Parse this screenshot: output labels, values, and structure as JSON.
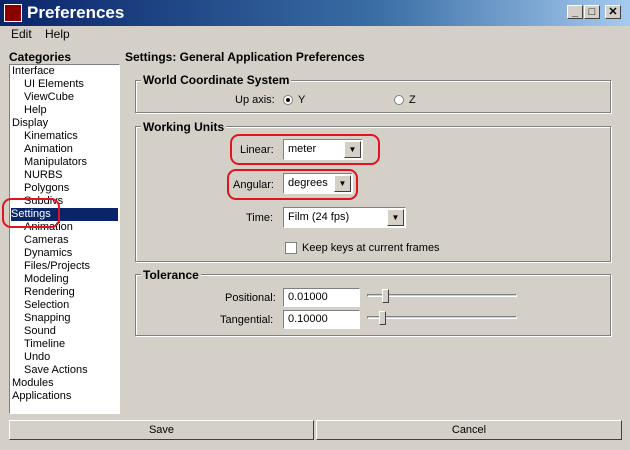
{
  "window": {
    "title": "Preferences",
    "minimize": "_",
    "maximize": "□",
    "close": "✕"
  },
  "menu": [
    "Edit",
    "Help"
  ],
  "categories": {
    "heading": "Categories",
    "items": [
      {
        "label": "Interface",
        "level": 0
      },
      {
        "label": "UI Elements",
        "level": 1
      },
      {
        "label": "ViewCube",
        "level": 1
      },
      {
        "label": "Help",
        "level": 1
      },
      {
        "label": "Display",
        "level": 0
      },
      {
        "label": "Kinematics",
        "level": 1
      },
      {
        "label": "Animation",
        "level": 1
      },
      {
        "label": "Manipulators",
        "level": 1
      },
      {
        "label": "NURBS",
        "level": 1
      },
      {
        "label": "Polygons",
        "level": 1
      },
      {
        "label": "Subdivs",
        "level": 1
      },
      {
        "label": "Settings",
        "level": 0,
        "selected": true
      },
      {
        "label": "Animation",
        "level": 1
      },
      {
        "label": "Cameras",
        "level": 1
      },
      {
        "label": "Dynamics",
        "level": 1
      },
      {
        "label": "Files/Projects",
        "level": 1
      },
      {
        "label": "Modeling",
        "level": 1
      },
      {
        "label": "Rendering",
        "level": 1
      },
      {
        "label": "Selection",
        "level": 1
      },
      {
        "label": "Snapping",
        "level": 1
      },
      {
        "label": "Sound",
        "level": 1
      },
      {
        "label": "Timeline",
        "level": 1
      },
      {
        "label": "Undo",
        "level": 1
      },
      {
        "label": "Save Actions",
        "level": 1
      },
      {
        "label": "Modules",
        "level": 0
      },
      {
        "label": "Applications",
        "level": 0
      }
    ]
  },
  "settings": {
    "heading": "Settings: General Application Preferences",
    "world": {
      "title": "World Coordinate System",
      "up_axis_label": "Up axis:",
      "options": [
        "Y",
        "Z"
      ],
      "selected": "Y"
    },
    "units": {
      "title": "Working Units",
      "linear_label": "Linear:",
      "linear_value": "meter",
      "angular_label": "Angular:",
      "angular_value": "degrees",
      "time_label": "Time:",
      "time_value": "Film (24 fps)",
      "keep_keys_label": "Keep keys at current frames",
      "keep_keys_checked": false
    },
    "tolerance": {
      "title": "Tolerance",
      "positional_label": "Positional:",
      "positional_value": "0.01000",
      "tangential_label": "Tangential:",
      "tangential_value": "0.10000"
    }
  },
  "buttons": {
    "save": "Save",
    "cancel": "Cancel"
  },
  "annotation_color": "#e0141e"
}
